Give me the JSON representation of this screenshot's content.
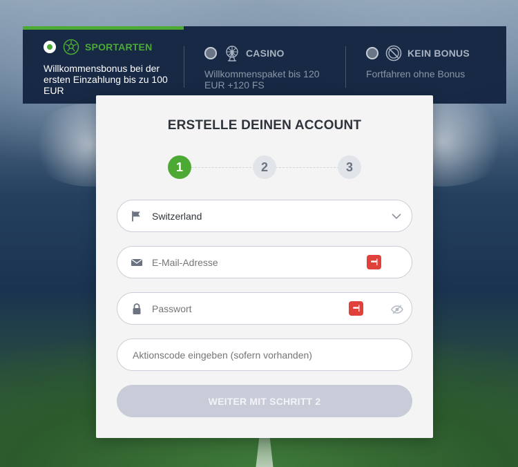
{
  "bonus_options": [
    {
      "title": "SPORTARTEN",
      "description": "Willkommensbonus bei der ersten Einzahlung bis zu 100 EUR",
      "icon": "soccer-ball-icon",
      "selected": true
    },
    {
      "title": "CASINO",
      "description": "Willkommenspaket bis 120 EUR +120 FS",
      "icon": "ferris-wheel-icon",
      "selected": false
    },
    {
      "title": "KEIN BONUS",
      "description": "Fortfahren ohne Bonus",
      "icon": "no-sign-icon",
      "selected": false
    }
  ],
  "form": {
    "title": "ERSTELLE DEINEN ACCOUNT",
    "steps": [
      "1",
      "2",
      "3"
    ],
    "active_step": 1,
    "country": {
      "value": "Switzerland",
      "icon": "flag-icon"
    },
    "email": {
      "placeholder": "E-Mail-Adresse",
      "icon": "envelope-icon"
    },
    "password": {
      "placeholder": "Passwort",
      "icon": "lock-icon"
    },
    "promo": {
      "placeholder": "Aktionscode eingeben (sofern vorhanden)"
    },
    "submit_label": "WEITER MIT SCHRITT 2"
  },
  "colors": {
    "accent": "#4ca934",
    "header_bg": "#132440",
    "button_disabled": "#c8ccd8",
    "password_manager_badge": "#e0413a"
  }
}
